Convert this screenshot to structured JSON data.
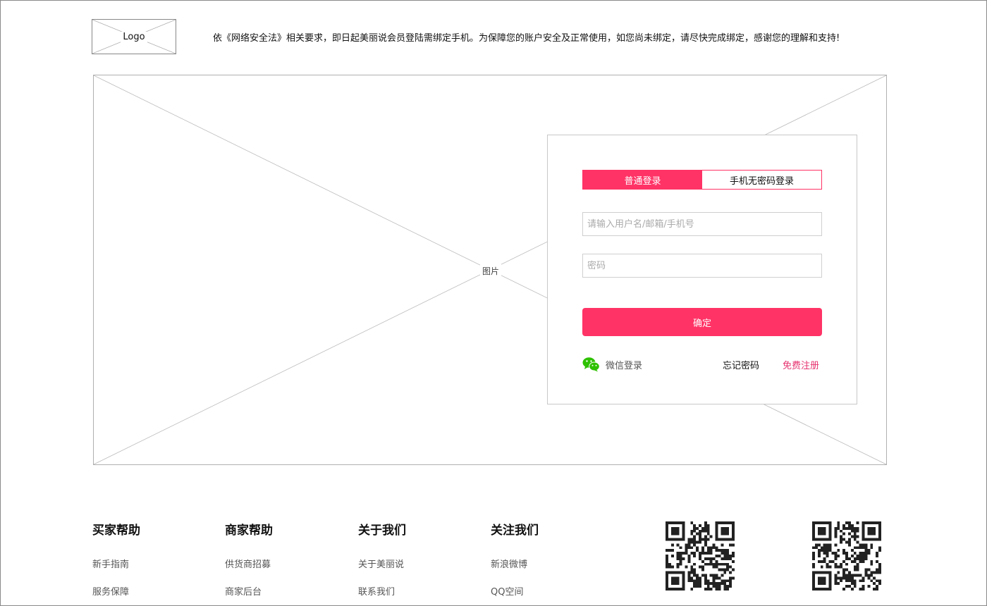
{
  "header": {
    "logo_text": "Logo",
    "notice": "依《网络安全法》相关要求，即日起美丽说会员登陆需绑定手机。为保障您的账户安全及正常使用，如您尚未绑定，请尽快完成绑定，感谢您的理解和支持!"
  },
  "hero": {
    "image_label": "图片"
  },
  "login": {
    "tabs": [
      {
        "label": "普通登录"
      },
      {
        "label": "手机无密码登录"
      }
    ],
    "username_placeholder": "请输入用户名/邮箱/手机号",
    "password_placeholder": "密码",
    "confirm_label": "确定",
    "wechat_label": "微信登录",
    "forgot_label": "忘记密码",
    "register_label": "免费注册",
    "accent_color": "#ff3366",
    "wechat_color": "#2dc100"
  },
  "footer": {
    "columns": [
      {
        "title": "买家帮助",
        "links": [
          "新手指南",
          "服务保障"
        ]
      },
      {
        "title": "商家帮助",
        "links": [
          "供货商招募",
          "商家后台"
        ]
      },
      {
        "title": "关于我们",
        "links": [
          "关于美丽说",
          "联系我们"
        ]
      },
      {
        "title": "关注我们",
        "links": [
          "新浪微博",
          "QQ空间"
        ]
      }
    ]
  }
}
